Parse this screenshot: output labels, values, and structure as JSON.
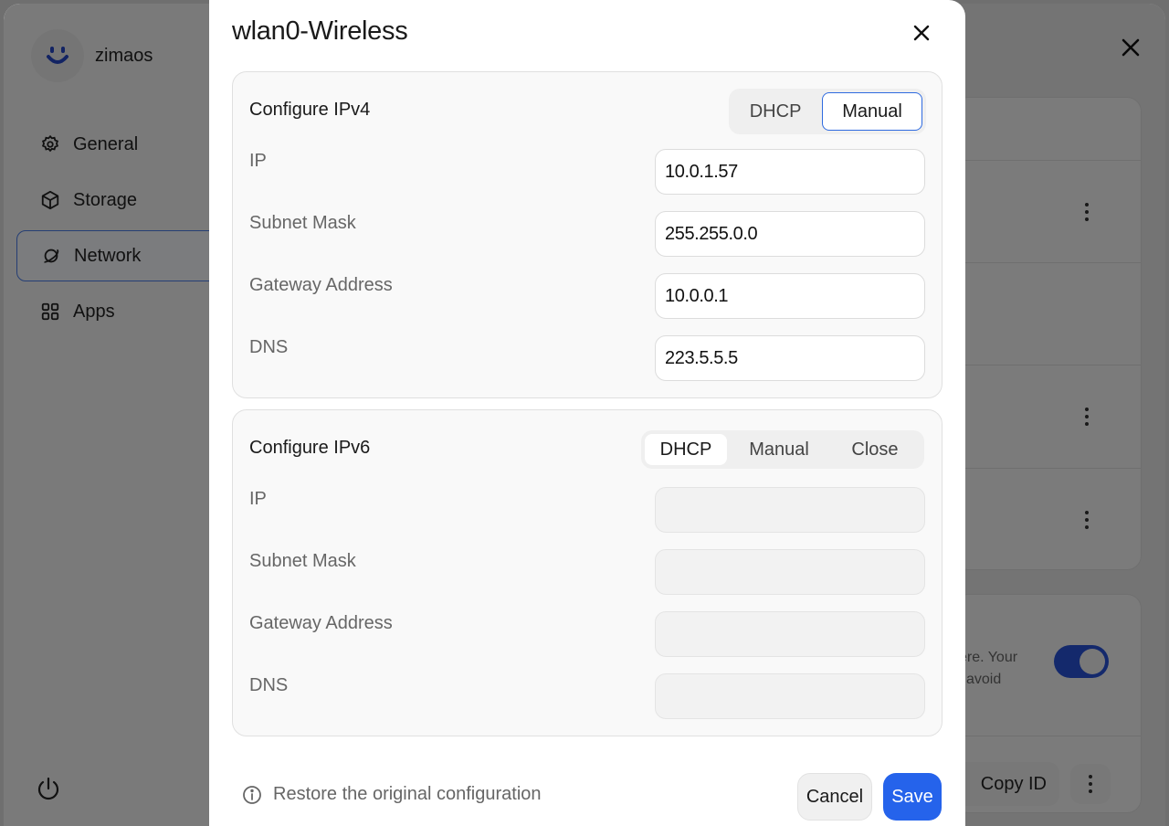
{
  "app": {
    "brand_name": "zimaos",
    "nav": [
      {
        "label": "General",
        "icon": "gear-icon"
      },
      {
        "label": "Storage",
        "icon": "cube-icon"
      },
      {
        "label": "Network",
        "icon": "planet-icon",
        "active": true
      },
      {
        "label": "Apps",
        "icon": "grid-icon"
      }
    ],
    "bg_text_line1": "ere. Your",
    "bg_text_line2": "l avoid",
    "copy_id_label": "Copy ID",
    "toggle_on": true
  },
  "modal": {
    "title": "wlan0-Wireless",
    "ipv4": {
      "title": "Configure IPv4",
      "modes": [
        "DHCP",
        "Manual"
      ],
      "selected_mode": "Manual",
      "fields": [
        {
          "label": "IP",
          "value": "10.0.1.57"
        },
        {
          "label": "Subnet Mask",
          "value": "255.255.0.0"
        },
        {
          "label": "Gateway Address",
          "value": "10.0.0.1"
        },
        {
          "label": "DNS",
          "value": "223.5.5.5"
        }
      ]
    },
    "ipv6": {
      "title": "Configure IPv6",
      "modes": [
        "DHCP",
        "Manual",
        "Close"
      ],
      "selected_mode": "DHCP",
      "fields": [
        {
          "label": "IP",
          "value": ""
        },
        {
          "label": "Subnet Mask",
          "value": ""
        },
        {
          "label": "Gateway Address",
          "value": ""
        },
        {
          "label": "DNS",
          "value": ""
        }
      ]
    },
    "restore_label": "Restore the original configuration",
    "cancel_label": "Cancel",
    "save_label": "Save"
  },
  "colors": {
    "accent": "#2563eb",
    "toggle": "#2853d8",
    "brand_face": "#2446c6"
  }
}
